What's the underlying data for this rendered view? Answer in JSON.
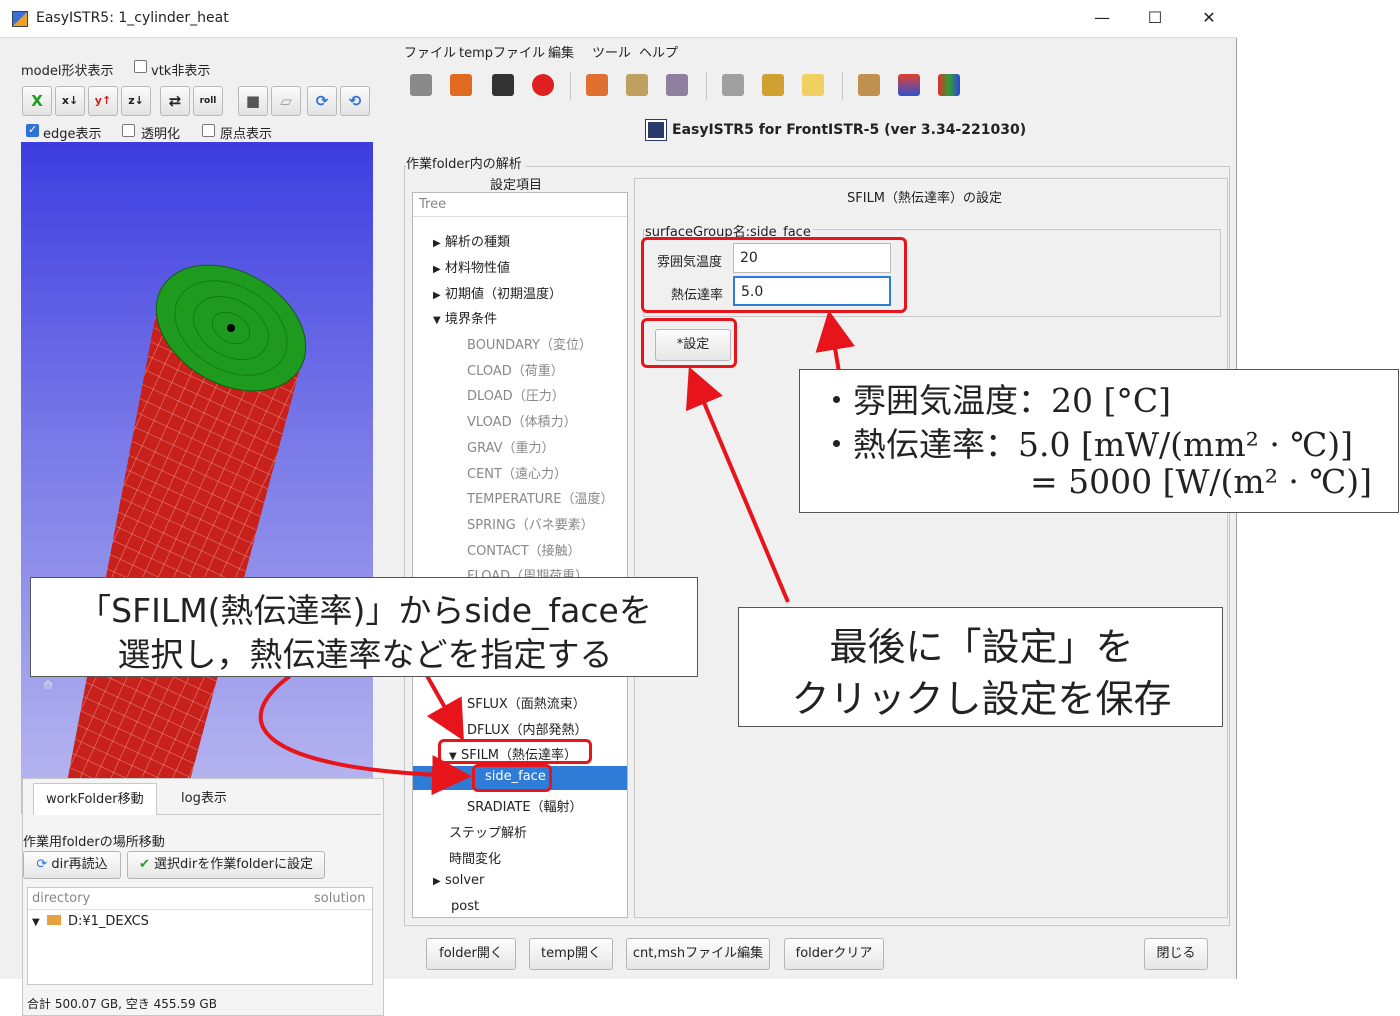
{
  "window": {
    "title": "EasyISTR5: 1_cylinder_heat",
    "minimize": "—",
    "maximize": "☐",
    "close": "✕"
  },
  "left": {
    "model_shape_label": "model形状表示",
    "vtk_hide_label": "vtk非表示",
    "edge_label": "edge表示",
    "transparent_label": "透明化",
    "origin_label": "原点表示",
    "toolbar": [
      "X",
      "x↓",
      "y↑",
      "z↓",
      "⇄",
      "roll",
      "■",
      "▱",
      "⟳",
      "⟲"
    ],
    "tabs": [
      "workFolder移動",
      "log表示"
    ],
    "workfolder_move_label": "作業用folderの場所移動",
    "reload_btn": "dir再読込",
    "set_workdir_btn": "選択dirを作業folderに設定",
    "col_directory": "directory",
    "col_solution": "solution",
    "root_dir": "D:¥1_DEXCS",
    "disk_status": "合計 500.07 GB, 空き 455.59 GB"
  },
  "menu": [
    "ファイル",
    "tempファイル",
    "編集",
    "ツール",
    "ヘルプ"
  ],
  "banner": "EasyISTR5 for FrontISTR-5  (ver 3.34-221030)",
  "section_label": "作業folder内の解析",
  "tree_header": "設定項目",
  "tree_label": "Tree",
  "tree": {
    "analysis_type": "解析の種類",
    "material": "材料物性値",
    "initial": "初期値（初期温度）",
    "boundary": "境界条件",
    "items": [
      "BOUNDARY（変位）",
      "CLOAD（荷重）",
      "DLOAD（圧力）",
      "VLOAD（体積力）",
      "GRAV（重力）",
      "CENT（遠心力）",
      "TEMPERATURE（温度）",
      "SPRING（バネ要素）",
      "CONTACT（接触）",
      "FLOAD（周期荷重）"
    ],
    "sflux": "SFLUX（面熱流束）",
    "dflux": "DFLUX（内部発熱）",
    "sfilm": "SFILM（熱伝達率）",
    "side_face": "side_face",
    "sradiate": "SRADIATE（輻射）",
    "step": "ステップ解析",
    "time": "時間変化",
    "solver": "solver",
    "post": "post"
  },
  "settings": {
    "title": "SFILM（熱伝達率）の設定",
    "group_label": "surfaceGroup名:side_face",
    "ambient_label": "雰囲気温度",
    "ambient_value": "20",
    "coef_label": "熱伝達率",
    "coef_value": "5.0",
    "set_button": "*設定"
  },
  "bottom_buttons": [
    "folder開く",
    "temp開く",
    "cnt,mshファイル編集",
    "folderクリア",
    "閉じる"
  ],
  "annotations": {
    "units_line1": "・雰囲気温度：20 [°C]",
    "units_line2": "・熱伝達率：5.0 [mW/(mm² · ℃)]",
    "units_line3": "= 5000 [W/(m² · ℃)]",
    "left_note_line1": "「SFILM(熱伝達率)」からside_faceを",
    "left_note_line2": "選択し，熱伝達率などを指定する",
    "right_note_line1": "最後に「設定」を",
    "right_note_line2": "クリックし設定を保存"
  }
}
